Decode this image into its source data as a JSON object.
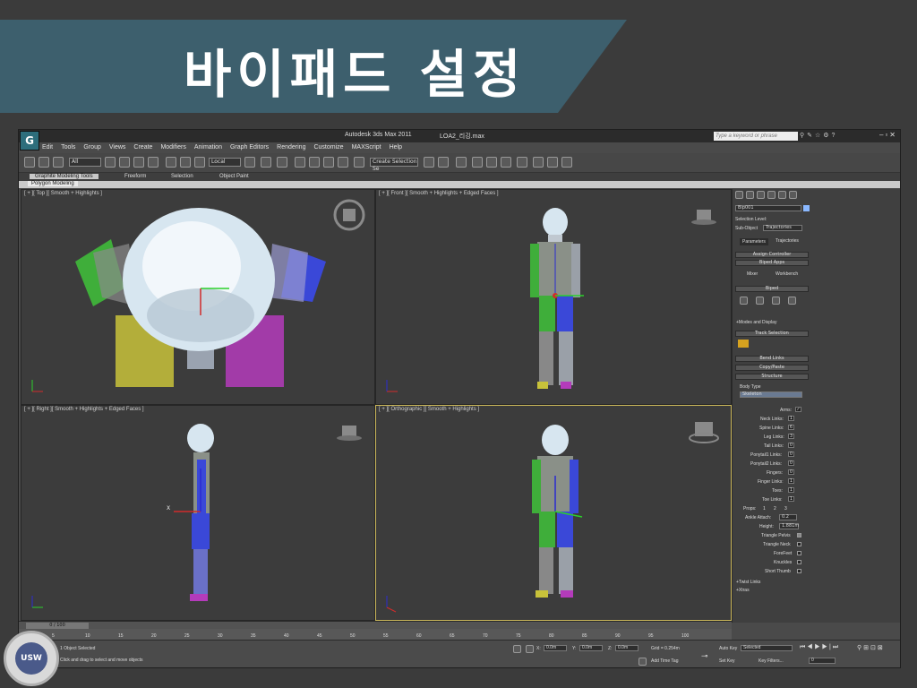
{
  "slide_title": "바이패드 설정",
  "app": {
    "title": "Autodesk 3ds Max  2011",
    "file": "LOA2_리깅.max",
    "search_placeholder": "Type a keyword or phrase",
    "menu": [
      "Edit",
      "Tools",
      "Group",
      "Views",
      "Create",
      "Modifiers",
      "Animation",
      "Graph Editors",
      "Rendering",
      "Customize",
      "MAXScript",
      "Help"
    ],
    "toolbar": {
      "selection_filter": "All",
      "ref_coord": "Local",
      "named_selection": "Create Selection Se"
    },
    "ribbon_tabs": [
      "Graphite Modeling Tools",
      "Freeform",
      "Selection",
      "Object Paint"
    ],
    "ribbon_sub": "Polygon Modeling",
    "viewports": [
      {
        "label": "[ + ][ Top ][ Smooth + Highlights ]"
      },
      {
        "label": "[ + ][ Front ][ Smooth + Highlights + Edged Faces ]"
      },
      {
        "label": "[ + ][ Right ][ Smooth + Highlights + Edged Faces ]"
      },
      {
        "label": "[ + ][ Orthographic ][ Smooth + Highlights ]"
      }
    ],
    "command_panel": {
      "object_name": "Bip001",
      "selection_level": "Selection Level:",
      "sub_object": "Sub-Object",
      "trajectories": "Trajectories",
      "tabs": [
        "Parameters",
        "Trajectories"
      ],
      "sections": [
        "Assign Controller",
        "Biped Apps",
        "Biped",
        "Track Selection",
        "Bend Links",
        "Copy/Paste",
        "Structure"
      ],
      "biped_apps": [
        "Mixer",
        "Workbench"
      ],
      "modes_display": "+Modes and Display",
      "body_type_label": "Body Type",
      "body_type_value": "Skeleton",
      "structure_fields": [
        {
          "label": "Arms:",
          "value": "✓"
        },
        {
          "label": "Neck Links:",
          "value": "1"
        },
        {
          "label": "Spine Links:",
          "value": "6"
        },
        {
          "label": "Leg Links:",
          "value": "3"
        },
        {
          "label": "Tail Links:",
          "value": "0"
        },
        {
          "label": "Ponytail1 Links:",
          "value": "0"
        },
        {
          "label": "Ponytail2 Links:",
          "value": "0"
        },
        {
          "label": "Fingers:",
          "value": "0"
        },
        {
          "label": "Finger Links:",
          "value": "1"
        },
        {
          "label": "Toes:",
          "value": "1"
        },
        {
          "label": "Toe Links:",
          "value": "1"
        }
      ],
      "props_label": "Props:",
      "props_values": [
        "1",
        "2",
        "3"
      ],
      "ankle_attach_label": "Ankle Attach:",
      "ankle_attach": "0.2",
      "height_label": "Height:",
      "height": "1.881m",
      "checkbox_fields": [
        {
          "label": "Triangle Pelvis",
          "checked": true
        },
        {
          "label": "Triangle Neck",
          "checked": false
        },
        {
          "label": "ForeFeet",
          "checked": false
        },
        {
          "label": "Knuckles",
          "checked": false
        },
        {
          "label": "Short Thumb",
          "checked": false
        }
      ],
      "twist_links": "+Twist Links",
      "xtras": "+Xtras"
    },
    "timeline": {
      "frame": "0 / 100",
      "ticks": [
        "0",
        "5",
        "10",
        "15",
        "20",
        "25",
        "30",
        "35",
        "40",
        "45",
        "50",
        "55",
        "60",
        "65",
        "70",
        "75",
        "80",
        "85",
        "90",
        "95",
        "100"
      ]
    },
    "status": {
      "selection": "1 Object Selected",
      "prompt": "Click and drag to select and move objects",
      "x": "0.0m",
      "y": "0.0m",
      "z": "0.0m",
      "grid": "Grid = 0.254m",
      "add_time_tag": "Add Time Tag",
      "auto_key": "Auto Key",
      "selected": "Selected",
      "set_key": "Set Key",
      "key_filters": "Key Filters...",
      "frame_field": "0"
    }
  },
  "seal_text": "USW"
}
